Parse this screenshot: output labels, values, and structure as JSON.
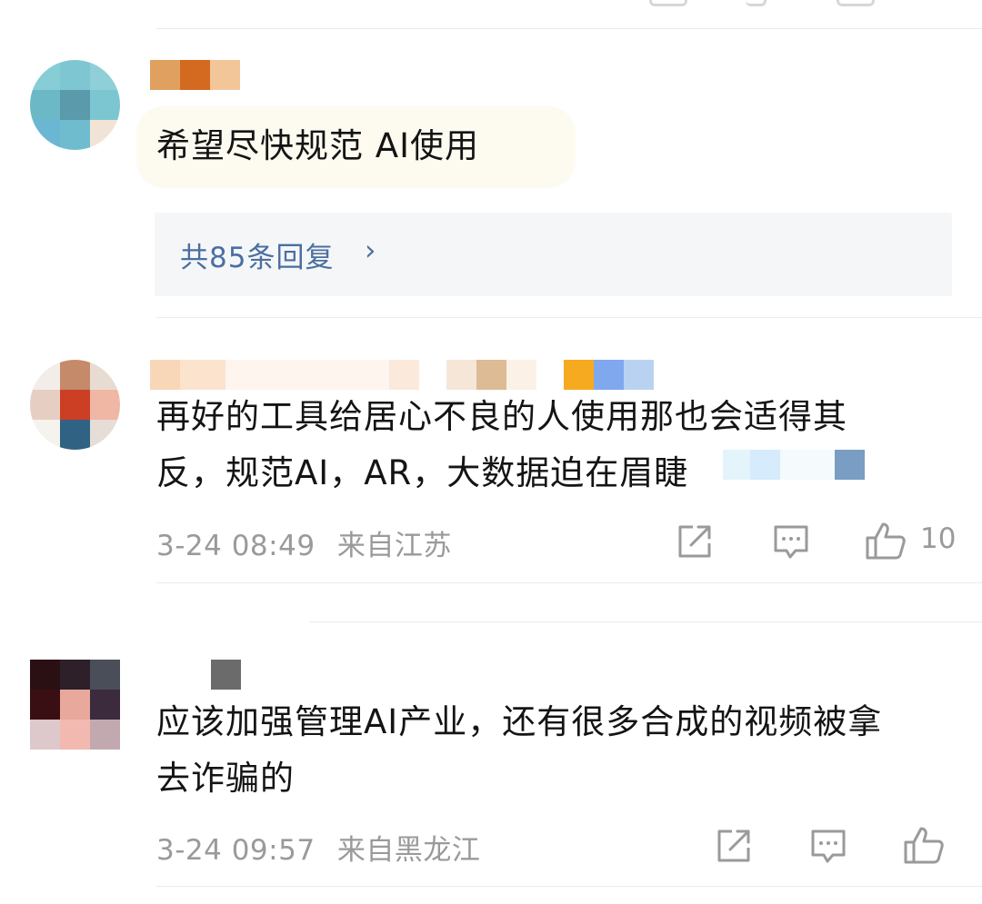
{
  "comments": [
    {
      "text": "希望尽快规范 AI使用",
      "replies_label": "共85条回复",
      "replies_chevron": "›"
    },
    {
      "text_line1": "再好的工具给居心不良的人使用那也会适得其",
      "text_line2": "反，规范AI，AR，大数据迫在眉睫",
      "date": "3-24 08:49",
      "location": "来自江苏",
      "like_count": "10"
    },
    {
      "text_line1": "应该加强管理AI产业，还有很多合成的视频被拿",
      "text_line2": "去诈骗的",
      "date": "3-24 09:57",
      "location": "来自黑龙江"
    }
  ],
  "icons": {
    "share": "share-icon",
    "comment": "comment-icon",
    "like": "thumbs-up-icon"
  }
}
